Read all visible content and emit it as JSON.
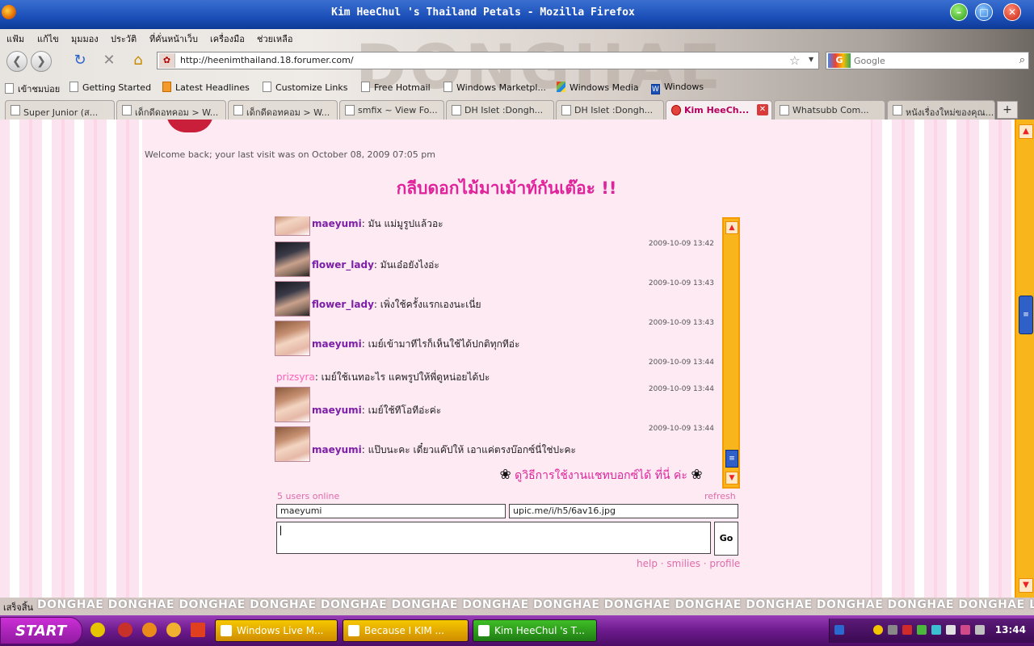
{
  "window": {
    "title": "Kim HeeChul 's Thailand Petals - Mozilla Firefox"
  },
  "menu": [
    "แฟ้ม",
    "แก้ไข",
    "มุมมอง",
    "ประวัติ",
    "ที่คั่นหน้าเว็บ",
    "เครื่องมือ",
    "ช่วยเหลือ"
  ],
  "navbar": {
    "url": "http://heenimthailand.18.forumer.com/",
    "search_placeholder": "Google"
  },
  "bookmarks": [
    "เข้าชมบ่อย",
    "Getting Started",
    "Latest Headlines",
    "Customize Links",
    "Free Hotmail",
    "Windows Marketpl...",
    "Windows Media",
    "Windows"
  ],
  "tabs": [
    {
      "label": "Super Junior (ส...",
      "active": false
    },
    {
      "label": "เด็กดีดอทคอม > W...",
      "active": false
    },
    {
      "label": "เด็กดีดอทคอม > W...",
      "active": false
    },
    {
      "label": "smfix ~ View Fo...",
      "active": false
    },
    {
      "label": "DH Islet :Dongh...",
      "active": false
    },
    {
      "label": "DH Islet :Dongh...",
      "active": false
    },
    {
      "label": "Kim HeeCh...",
      "active": true
    },
    {
      "label": "Whatsubb Com...",
      "active": false
    },
    {
      "label": "หนังเรื่องใหม่ของคุณ...",
      "active": false
    }
  ],
  "page": {
    "welcome": "Welcome back; your last visit was on October 08, 2009 07:05 pm",
    "heading": "กลีบดอกไม้มาเม้าท์กันเต๊อะ !!",
    "chat": [
      {
        "user": "maeyumi",
        "text": ": มัน แม่มูรูปแล้วอะ",
        "time": "",
        "avatar": "girl"
      },
      {
        "user": "flower_lady",
        "text": ": มันเอ๋อยังไงอ่ะ",
        "time": "2009-10-09 13:42",
        "avatar": "boy"
      },
      {
        "user": "flower_lady",
        "text": ": เพิ่งใช้ครั้งแรกเองนะเนี่ย",
        "time": "2009-10-09 13:43",
        "avatar": "boy"
      },
      {
        "user": "maeyumi",
        "text": ": เมย์เข้ามาทีไรก็เห็นใช้ได้ปกติทุกทีอ่ะ",
        "time": "2009-10-09 13:43",
        "avatar": "girl"
      },
      {
        "user": "prizsyra",
        "text": ": เมย์ใช้เนทอะไร แคพรูปให้พี่ดูหน่อยได้ปะ",
        "time": "2009-10-09 13:44",
        "avatar": ""
      },
      {
        "user": "maeyumi",
        "text": ": เมย์ใช้ทีโอทีอ่ะค่ะ",
        "time": "2009-10-09 13:44",
        "avatar": "girl"
      },
      {
        "user": "maeyumi",
        "text": ": แป๊บนะคะ เดี๋ยวแค๊ปให้ เอาแค่ตรงบ๊อกซ์นี่ใช่ปะคะ",
        "time": "2009-10-09 13:44",
        "avatar": "girl"
      }
    ],
    "howto": "ดูวิธีการใช้งานแชทบอกซ์ได้ ที่นี่ ค่ะ",
    "online": "5 users online",
    "refresh": "refresh",
    "nickname": "maeyumi",
    "image_url": "upic.me/i/h5/6av16.jpg",
    "go": "Go",
    "links": "help · smilies · profile"
  },
  "statusbar": {
    "status": "เสร็จสิ้น",
    "ticker": "DONGHAE DONGHAE DONGHAE DONGHAE DONGHAE DONGHAE DONGHAE DONGHAE DONGHAE DONGHAE DONGHAE DONGHAE DONGHAE DONGHAE LEE DONGHAE."
  },
  "taskbar": {
    "start": "START",
    "items": [
      {
        "label": "Windows Live M...",
        "active": false
      },
      {
        "label": "Because I KIM ...",
        "active": false
      },
      {
        "label": "Kim HeeChul 's T...",
        "active": true
      }
    ],
    "clock": "13:44"
  }
}
